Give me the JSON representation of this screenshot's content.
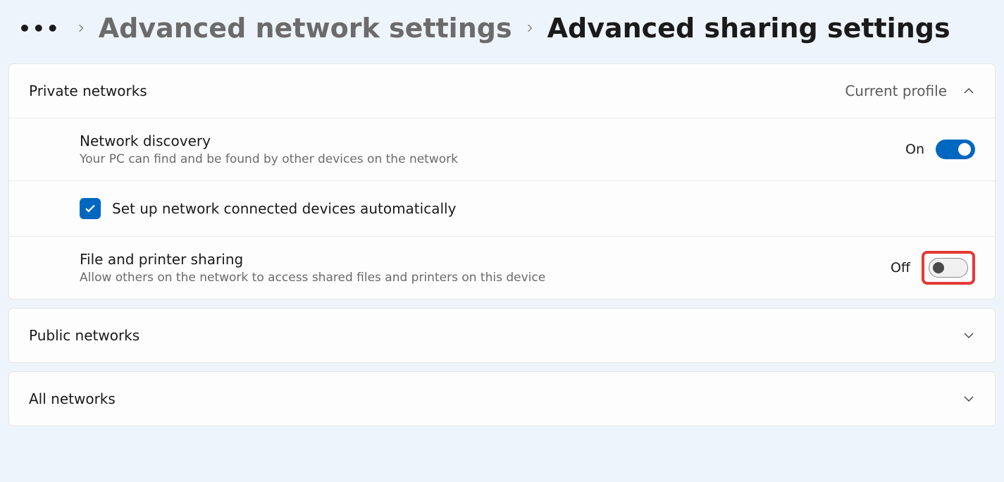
{
  "breadcrumb": {
    "ellipsis": "•••",
    "parent": "Advanced network settings",
    "current": "Advanced sharing settings"
  },
  "private": {
    "title": "Private networks",
    "badge": "Current profile",
    "network_discovery": {
      "title": "Network discovery",
      "desc": "Your PC can find and be found by other devices on the network",
      "state_label": "On",
      "on": true
    },
    "auto_setup": {
      "label": "Set up network connected devices automatically",
      "checked": true
    },
    "file_printer": {
      "title": "File and printer sharing",
      "desc": "Allow others on the network to access shared files and printers on this device",
      "state_label": "Off",
      "on": false
    }
  },
  "public": {
    "title": "Public networks"
  },
  "all": {
    "title": "All networks"
  }
}
